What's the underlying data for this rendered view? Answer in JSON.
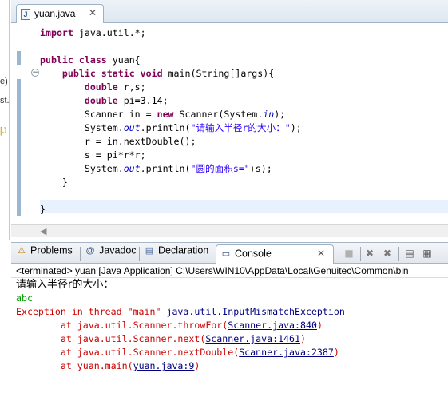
{
  "left_strip": {
    "fragments": [
      "e)",
      "st.",
      "[J"
    ]
  },
  "editor": {
    "tab": {
      "icon": "java-file-icon",
      "label": "yuan.java",
      "close_glyph": "✕"
    },
    "lines": [
      [
        {
          "t": "import",
          "c": "kw"
        },
        {
          "t": " java.util.*;"
        }
      ],
      [],
      [
        {
          "t": "public",
          "c": "kw"
        },
        {
          "t": " "
        },
        {
          "t": "class",
          "c": "kw"
        },
        {
          "t": " yuan{"
        }
      ],
      [
        {
          "t": "    "
        },
        {
          "t": "public",
          "c": "kw"
        },
        {
          "t": " "
        },
        {
          "t": "static",
          "c": "kw"
        },
        {
          "t": " "
        },
        {
          "t": "void",
          "c": "kw"
        },
        {
          "t": " main(String[]args){"
        }
      ],
      [
        {
          "t": "        "
        },
        {
          "t": "double",
          "c": "kw"
        },
        {
          "t": " r,s;"
        }
      ],
      [
        {
          "t": "        "
        },
        {
          "t": "double",
          "c": "kw"
        },
        {
          "t": " pi=3.14;"
        }
      ],
      [
        {
          "t": "        Scanner in = "
        },
        {
          "t": "new",
          "c": "kw"
        },
        {
          "t": " Scanner(System."
        },
        {
          "t": "in",
          "c": "fi"
        },
        {
          "t": ");"
        }
      ],
      [
        {
          "t": "        System."
        },
        {
          "t": "out",
          "c": "fi"
        },
        {
          "t": ".println("
        },
        {
          "t": "\"请输入半径r的大小：\"",
          "c": "st"
        },
        {
          "t": ");"
        }
      ],
      [
        {
          "t": "        r = in.nextDouble();"
        }
      ],
      [
        {
          "t": "        s = pi*r*r;"
        }
      ],
      [
        {
          "t": "        System."
        },
        {
          "t": "out",
          "c": "fi"
        },
        {
          "t": ".println("
        },
        {
          "t": "\"圆的面积s=\"",
          "c": "st"
        },
        {
          "t": "+s);"
        }
      ],
      [
        {
          "t": "    }"
        }
      ],
      [],
      [
        {
          "t": "}"
        }
      ]
    ]
  },
  "panel": {
    "tabs": [
      {
        "id": "problems",
        "icon": "problems-icon",
        "glyph": "⚠",
        "label": "Problems",
        "active": false
      },
      {
        "id": "javadoc",
        "icon": "at-icon",
        "glyph": "@",
        "label": "Javadoc",
        "active": false
      },
      {
        "id": "declaration",
        "icon": "declaration-icon",
        "glyph": "▤",
        "label": "Declaration",
        "active": false
      },
      {
        "id": "console",
        "icon": "console-icon",
        "glyph": "▭",
        "label": "Console",
        "active": true,
        "close_glyph": "✕"
      }
    ],
    "toolbar": [
      {
        "name": "terminate-icon",
        "glyph": "■"
      },
      {
        "name": "remove-launch-icon",
        "glyph": "✖"
      },
      {
        "name": "remove-all-icon",
        "glyph": "✖"
      },
      {
        "name": "clear-console-icon",
        "glyph": "▤"
      },
      {
        "name": "scroll-lock-icon",
        "glyph": "▦"
      }
    ],
    "terminated_line": "<terminated> yuan [Java Application] C:\\Users\\WIN10\\AppData\\Local\\Genuitec\\Common\\bin"
  },
  "console": {
    "lines": [
      [
        {
          "t": "请输入半径r的大小：",
          "c": "out"
        }
      ],
      [
        {
          "t": "abc",
          "c": "inp"
        }
      ],
      [
        {
          "t": "Exception in thread \"main\" ",
          "c": "err"
        },
        {
          "t": "java.util.InputMismatchException",
          "c": "lnk"
        }
      ],
      [
        {
          "t": "        at java.util.Scanner.throwFor(",
          "c": "err"
        },
        {
          "t": "Scanner.java:840",
          "c": "lnk"
        },
        {
          "t": ")",
          "c": "err"
        }
      ],
      [
        {
          "t": "        at java.util.Scanner.next(",
          "c": "err"
        },
        {
          "t": "Scanner.java:1461",
          "c": "lnk"
        },
        {
          "t": ")",
          "c": "err"
        }
      ],
      [
        {
          "t": "        at java.util.Scanner.nextDouble(",
          "c": "err"
        },
        {
          "t": "Scanner.java:2387",
          "c": "lnk"
        },
        {
          "t": ")",
          "c": "err"
        }
      ],
      [
        {
          "t": "        at yuan.main(",
          "c": "err"
        },
        {
          "t": "yuan.java:9",
          "c": "lnk"
        },
        {
          "t": ")",
          "c": "err"
        }
      ]
    ]
  },
  "colors": {
    "keyword": "#7f0055",
    "string": "#2a00ff",
    "field": "#0000c0",
    "error": "#cc0000",
    "input": "#009900",
    "link": "#000080"
  }
}
